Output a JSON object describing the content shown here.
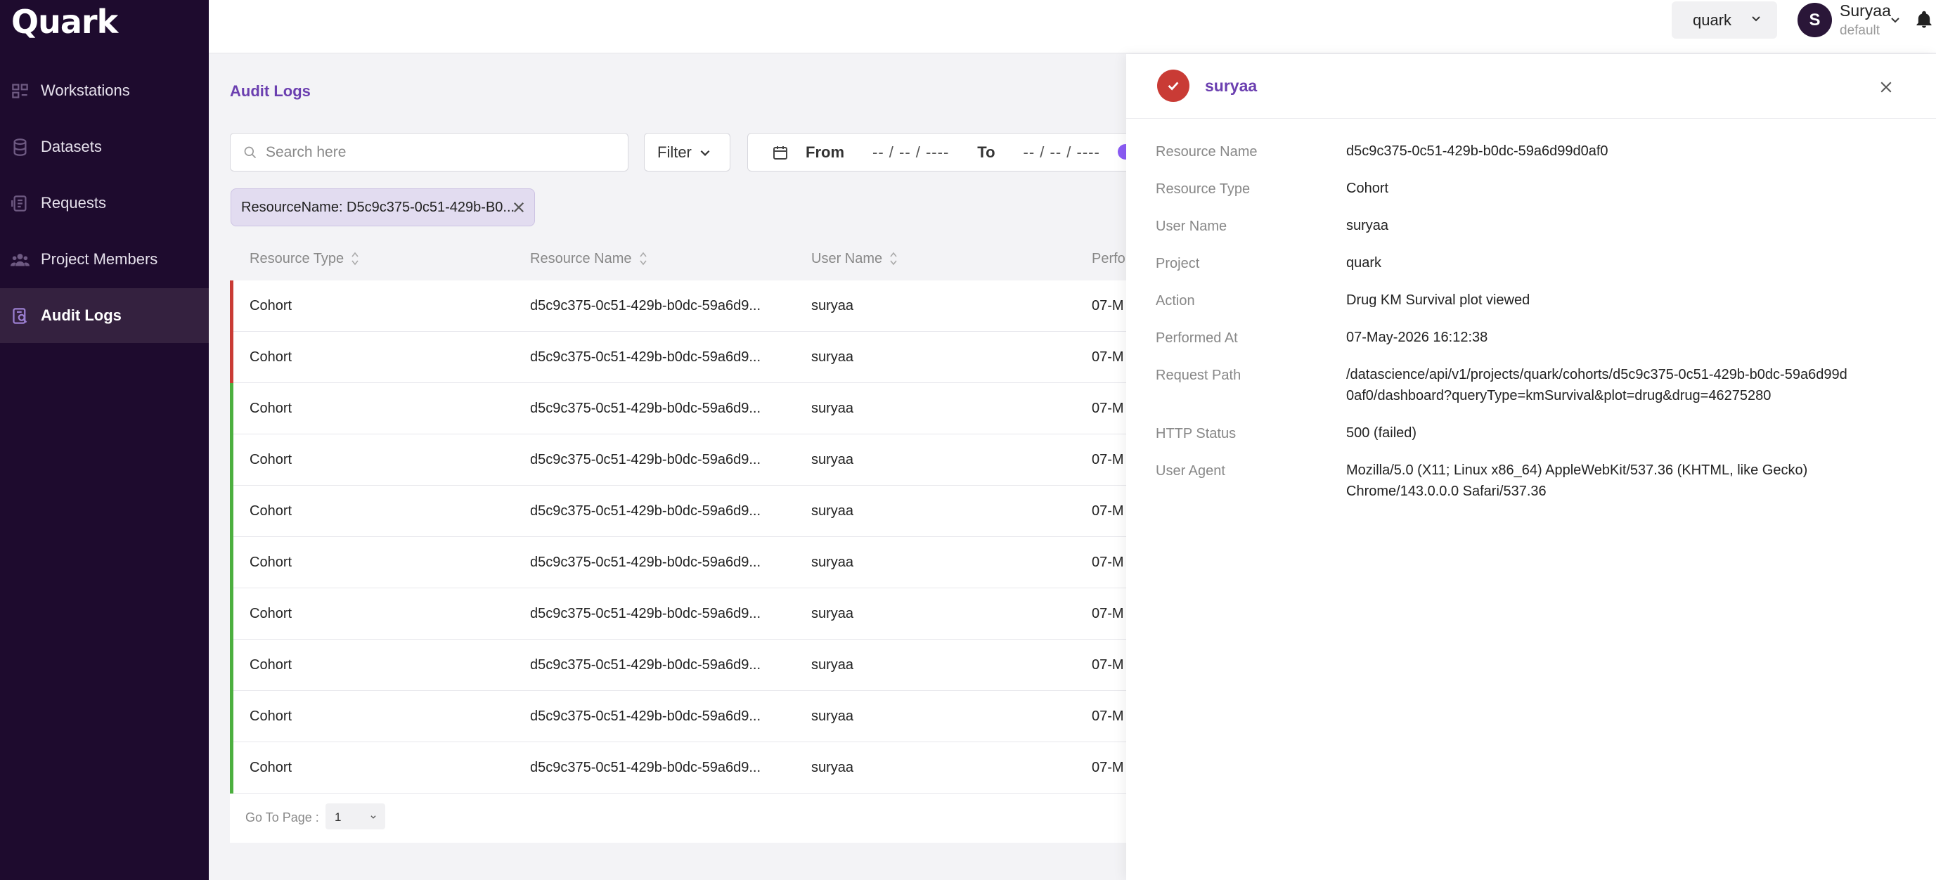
{
  "app": {
    "logo": "Quark"
  },
  "sidebar": {
    "items": [
      {
        "label": "Workstations",
        "icon": "workstation-icon",
        "active": false
      },
      {
        "label": "Datasets",
        "icon": "database-icon",
        "active": false
      },
      {
        "label": "Requests",
        "icon": "requests-icon",
        "active": false
      },
      {
        "label": "Project Members",
        "icon": "users-icon",
        "active": false
      },
      {
        "label": "Audit Logs",
        "icon": "audit-icon",
        "active": true
      }
    ]
  },
  "header": {
    "project": "quark",
    "avatar_initial": "S",
    "user_name": "Suryaa",
    "user_role": "default"
  },
  "main": {
    "title": "Audit Logs",
    "search_placeholder": "Search here",
    "filter_label": "Filter",
    "from_label": "From",
    "to_label": "To",
    "from_placeholder": "-- / -- / ----",
    "to_placeholder": "-- / -- / ----",
    "chip_label": "ResourceName: D5c9c375-0c51-429b-B0..."
  },
  "table": {
    "columns": [
      "Resource Type",
      "Resource Name",
      "User Name",
      "Perfo"
    ],
    "rows": [
      {
        "type": "Cohort",
        "name": "d5c9c375-0c51-429b-b0dc-59a6d9...",
        "user": "suryaa",
        "performed": "07-M",
        "status": "failed"
      },
      {
        "type": "Cohort",
        "name": "d5c9c375-0c51-429b-b0dc-59a6d9...",
        "user": "suryaa",
        "performed": "07-M",
        "status": "failed"
      },
      {
        "type": "Cohort",
        "name": "d5c9c375-0c51-429b-b0dc-59a6d9...",
        "user": "suryaa",
        "performed": "07-M",
        "status": "success"
      },
      {
        "type": "Cohort",
        "name": "d5c9c375-0c51-429b-b0dc-59a6d9...",
        "user": "suryaa",
        "performed": "07-M",
        "status": "success"
      },
      {
        "type": "Cohort",
        "name": "d5c9c375-0c51-429b-b0dc-59a6d9...",
        "user": "suryaa",
        "performed": "07-M",
        "status": "success"
      },
      {
        "type": "Cohort",
        "name": "d5c9c375-0c51-429b-b0dc-59a6d9...",
        "user": "suryaa",
        "performed": "07-M",
        "status": "success"
      },
      {
        "type": "Cohort",
        "name": "d5c9c375-0c51-429b-b0dc-59a6d9...",
        "user": "suryaa",
        "performed": "07-M",
        "status": "success"
      },
      {
        "type": "Cohort",
        "name": "d5c9c375-0c51-429b-b0dc-59a6d9...",
        "user": "suryaa",
        "performed": "07-M",
        "status": "success"
      },
      {
        "type": "Cohort",
        "name": "d5c9c375-0c51-429b-b0dc-59a6d9...",
        "user": "suryaa",
        "performed": "07-M",
        "status": "success"
      },
      {
        "type": "Cohort",
        "name": "d5c9c375-0c51-429b-b0dc-59a6d9...",
        "user": "suryaa",
        "performed": "07-M",
        "status": "success"
      }
    ],
    "status_colors": {
      "failed": "#c93b35",
      "success": "#4caf3f"
    }
  },
  "pager": {
    "label": "Go To Page :",
    "page": "1"
  },
  "drawer": {
    "title": "suryaa",
    "fields": [
      {
        "label": "Resource Name",
        "value": "d5c9c375-0c51-429b-b0dc-59a6d99d0af0"
      },
      {
        "label": "Resource Type",
        "value": "Cohort"
      },
      {
        "label": "User Name",
        "value": "suryaa"
      },
      {
        "label": "Project",
        "value": "quark"
      },
      {
        "label": "Action",
        "value": "Drug KM Survival plot viewed"
      },
      {
        "label": "Performed At",
        "value": "07-May-2026 16:12:38"
      },
      {
        "label": "Request Path",
        "value": "/datascience/api/v1/projects/quark/cohorts/d5c9c375-0c51-429b-b0dc-59a6d99d0af0/dashboard?queryType=kmSurvival&plot=drug&drug=46275280"
      },
      {
        "label": "HTTP Status",
        "value": "500 (failed)"
      },
      {
        "label": "User Agent",
        "value": "Mozilla/5.0 (X11; Linux x86_64) AppleWebKit/537.36 (KHTML, like Gecko) Chrome/143.0.0.0 Safari/537.36"
      }
    ]
  },
  "colors": {
    "accent": "#6b3fb0",
    "sidebar": "#1e0b2e",
    "failed": "#c93b35"
  }
}
